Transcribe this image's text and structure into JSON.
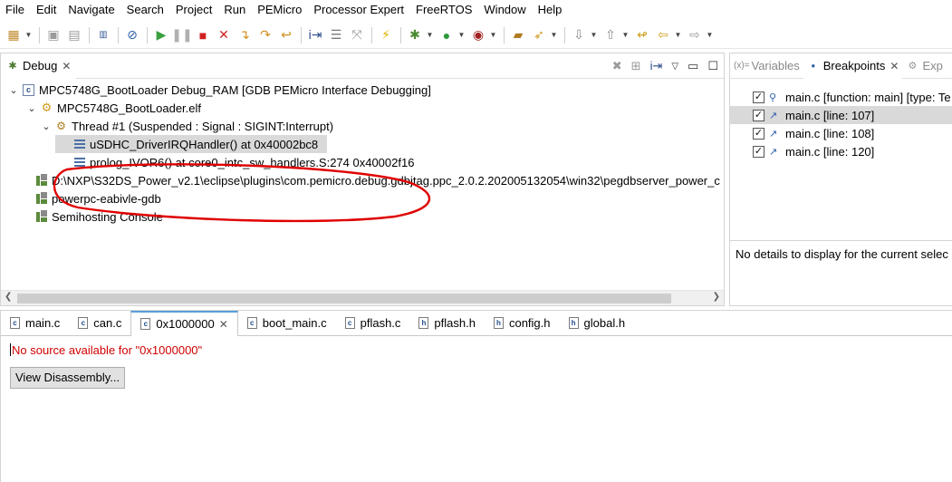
{
  "menubar": [
    "File",
    "Edit",
    "Navigate",
    "Search",
    "Project",
    "Run",
    "PEMicro",
    "Processor Expert",
    "FreeRTOS",
    "Window",
    "Help"
  ],
  "toolbar": {
    "icons": [
      "new-icon",
      "save-icon",
      "save-all-icon",
      "memory-icon",
      "skip-breakpoints-icon",
      "resume-icon",
      "suspend-icon",
      "terminate-icon",
      "disconnect-icon",
      "step-into-icon",
      "step-over-icon",
      "step-return-icon",
      "instruction-step-icon",
      "drop-to-frame-icon",
      "connect-icon",
      "debug-icon",
      "run-icon",
      "external-tools-icon",
      "open-task-icon",
      "open-perspective-icon",
      "next-annotation-icon",
      "prev-annotation-icon",
      "last-edit-icon",
      "back-icon",
      "forward-icon"
    ]
  },
  "debug_view": {
    "tab_label": "Debug",
    "tree": [
      {
        "level": 0,
        "expanded": true,
        "icon": "launch-config-icon",
        "label": "MPC5748G_BootLoader Debug_RAM [GDB PEMicro Interface Debugging]"
      },
      {
        "level": 1,
        "expanded": true,
        "icon": "debug-target-icon",
        "label": "MPC5748G_BootLoader.elf"
      },
      {
        "level": 2,
        "expanded": true,
        "icon": "thread-suspended-icon",
        "label": "Thread #1 (Suspended : Signal : SIGINT:Interrupt)"
      },
      {
        "level": 3,
        "expanded": null,
        "icon": "stack-frame-icon",
        "label": "uSDHC_DriverIRQHandler() at 0x40002bc8",
        "selected": true
      },
      {
        "level": 3,
        "expanded": null,
        "icon": "stack-frame-icon",
        "label": "prolog_IVOR6() at core0_intc_sw_handlers.S:274 0x40002f16"
      },
      {
        "level": 1,
        "expanded": null,
        "icon": "process-icon",
        "label": "D:\\NXP\\S32DS_Power_v2.1\\eclipse\\plugins\\com.pemicro.debug.gdbjtag.ppc_2.0.2.202005132054\\win32\\pegdbserver_power_c"
      },
      {
        "level": 1,
        "expanded": null,
        "icon": "process-icon",
        "label": "powerpc-eabivle-gdb"
      },
      {
        "level": 1,
        "expanded": null,
        "icon": "process-icon",
        "label": "Semihosting Console"
      }
    ]
  },
  "right_view": {
    "tabs": [
      {
        "label": "Variables",
        "prefix": "(x)=",
        "active": false
      },
      {
        "label": "Breakpoints",
        "active": true
      },
      {
        "label": "Exp",
        "active": false
      }
    ],
    "breakpoints": [
      {
        "checked": true,
        "label": "main.c [function: main] [type: Te",
        "icon": "function-breakpoint-icon",
        "selected": false
      },
      {
        "checked": true,
        "label": "main.c [line: 107]",
        "icon": "line-breakpoint-icon",
        "selected": true
      },
      {
        "checked": true,
        "label": "main.c [line: 108]",
        "icon": "line-breakpoint-icon",
        "selected": false
      },
      {
        "checked": true,
        "label": "main.c [line: 120]",
        "icon": "line-breakpoint-icon",
        "selected": false
      }
    ],
    "details": "No details to display for the current selec"
  },
  "editor": {
    "tabs": [
      {
        "label": "main.c",
        "type": "c",
        "active": false
      },
      {
        "label": "can.c",
        "type": "c",
        "active": false
      },
      {
        "label": "0x1000000",
        "type": "c",
        "active": true
      },
      {
        "label": "boot_main.c",
        "type": "c",
        "active": false
      },
      {
        "label": "pflash.c",
        "type": "c",
        "active": false
      },
      {
        "label": "pflash.h",
        "type": "h",
        "active": false
      },
      {
        "label": "config.h",
        "type": "h",
        "active": false
      },
      {
        "label": "global.h",
        "type": "h",
        "active": false
      }
    ],
    "message": "No source available for \"0x1000000\"",
    "button": "View Disassembly..."
  },
  "colors": {
    "annotation": "#e00000",
    "error_text": "#d00000",
    "selection": "#d9d9d9",
    "active_tab_accent": "#5aa0dc"
  }
}
